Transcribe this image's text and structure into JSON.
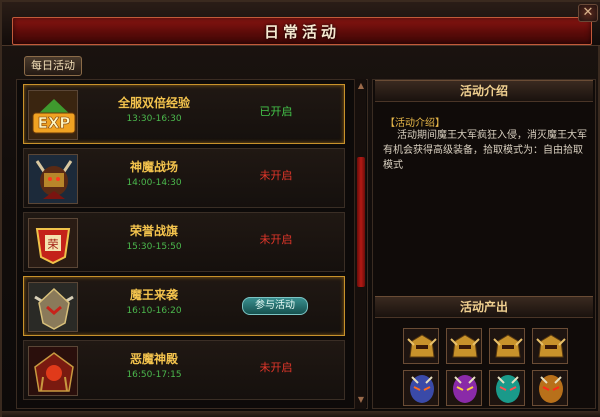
{
  "window": {
    "title": "日常活动"
  },
  "tabs": [
    {
      "label": "每日活动"
    }
  ],
  "activities": [
    {
      "name": "全服双倍经验",
      "time": "13:30-16:30",
      "status": "已开启",
      "status_kind": "open",
      "icon": "exp-icon"
    },
    {
      "name": "神魔战场",
      "time": "14:00-14:30",
      "status": "未开启",
      "status_kind": "closed",
      "icon": "demon-warrior-icon"
    },
    {
      "name": "荣誉战旗",
      "time": "15:30-15:50",
      "status": "未开启",
      "status_kind": "closed",
      "icon": "honor-banner-icon"
    },
    {
      "name": "魔王来袭",
      "time": "16:10-16:20",
      "status": "参与活动",
      "status_kind": "join",
      "icon": "demon-king-icon"
    },
    {
      "name": "恶魔神殿",
      "time": "16:50-17:15",
      "status": "未开启",
      "status_kind": "closed",
      "icon": "demon-temple-icon"
    }
  ],
  "intro": {
    "header": "活动介绍",
    "title": "【活动介绍】",
    "body": "活动期间魔王大军疯狂入侵，消灭魔王大军有机会获得高级装备，拾取模式为：自由拾取模式"
  },
  "rewards": {
    "header": "活动产出",
    "items": [
      "gold-helmet-icon",
      "gold-helmet-icon",
      "gold-helmet-icon",
      "gold-helmet-icon",
      "blue-mask-icon",
      "purple-mask-icon",
      "teal-mask-icon",
      "orange-mask-icon"
    ]
  },
  "colors": {
    "accent_red": "#8b1612",
    "name_gold": "#f3c34d",
    "time_green": "#4bb84d",
    "status_open": "#44c64a",
    "status_closed": "#e2362a",
    "selected_border": "#c8922b"
  }
}
